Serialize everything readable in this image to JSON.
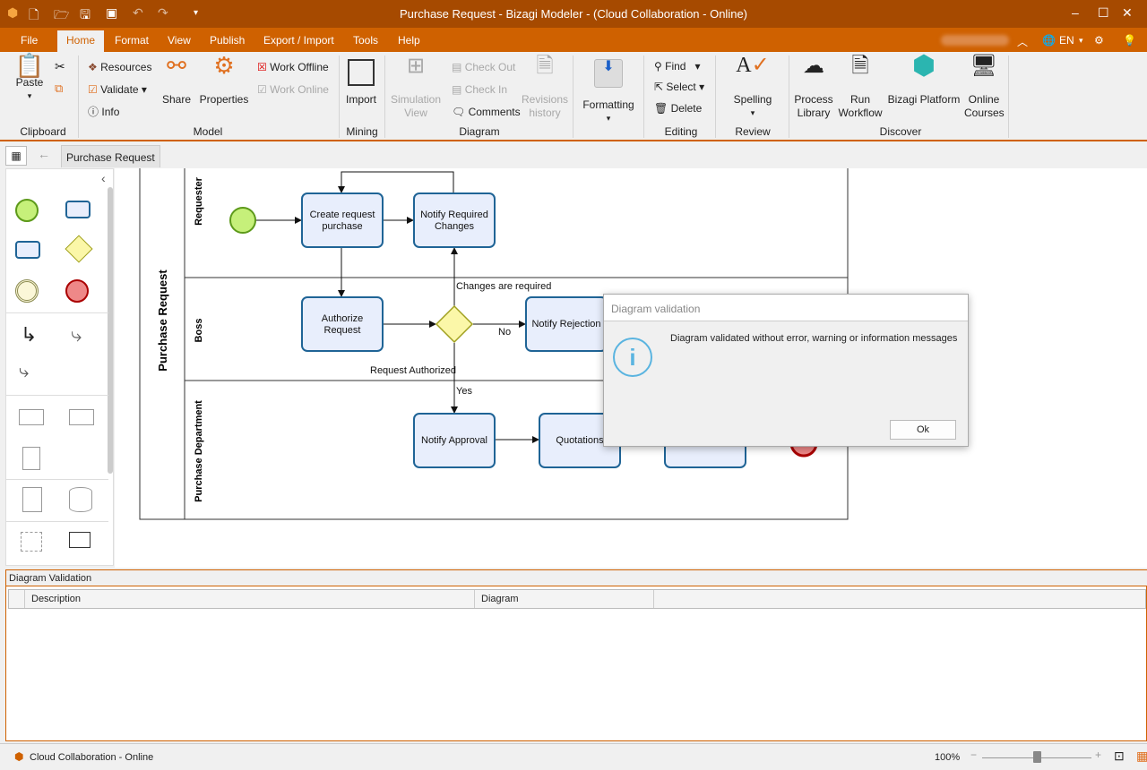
{
  "window": {
    "title": "Purchase Request - Bizagi Modeler - (Cloud Collaboration - Online)",
    "language": "EN"
  },
  "menu": [
    "File",
    "Home",
    "Format",
    "View",
    "Publish",
    "Export / Import",
    "Tools",
    "Help"
  ],
  "ribbon": {
    "clipboard": {
      "paste": "Paste",
      "group": "Clipboard"
    },
    "model": {
      "resources": "Resources",
      "validate": "Validate",
      "info": "Info",
      "share": "Share",
      "properties": "Properties",
      "work_offline": "Work Offline",
      "work_online": "Work Online",
      "group": "Model"
    },
    "mining": {
      "import": "Import",
      "group": "Mining"
    },
    "diagram": {
      "simulation_1": "Simulation",
      "simulation_2": "View",
      "check_out": "Check Out",
      "check_in": "Check In",
      "comments": "Comments",
      "revisions_1": "Revisions",
      "revisions_2": "history",
      "group": "Diagram"
    },
    "formatting": {
      "label": "Formatting"
    },
    "editing": {
      "find": "Find",
      "select": "Select",
      "delete": "Delete",
      "group": "Editing"
    },
    "review": {
      "spelling": "Spelling",
      "group": "Review"
    },
    "discover": {
      "process_1": "Process",
      "process_2": "Library",
      "run_1": "Run",
      "run_2": "Workflow",
      "platform": "Bizagi Platform",
      "courses_1": "Online",
      "courses_2": "Courses",
      "group": "Discover"
    }
  },
  "tabs": {
    "active": "Purchase Request"
  },
  "diagram": {
    "pool": "Purchase Request",
    "lanes": [
      "Requester",
      "Boss",
      "Purchase Department"
    ],
    "tasks": {
      "create_1": "Create request",
      "create_2": "purchase",
      "notify_changes_1": "Notify Required",
      "notify_changes_2": "Changes",
      "authorize_1": "Authorize",
      "authorize_2": "Request",
      "rejection": "Notify Rejection",
      "approval": "Notify Approval",
      "quotations": "Quotations"
    },
    "flows": {
      "changes": "Changes are required",
      "no": "No",
      "authorized": "Request Authorized",
      "yes": "Yes"
    }
  },
  "dialog": {
    "title": "Diagram validation",
    "message": "Diagram validated without error, warning or information messages",
    "ok": "Ok"
  },
  "validation_panel": {
    "title": "Diagram Validation",
    "columns": [
      "Description",
      "Diagram"
    ]
  },
  "status": {
    "connection": "Cloud Collaboration - Online",
    "zoom": "100%",
    "zoom_level": 0.5
  },
  "colors": {
    "accent": "#cf6100",
    "title": "#a64a00",
    "task_fill": "#e8eefc",
    "task_stroke": "#1f6496"
  }
}
